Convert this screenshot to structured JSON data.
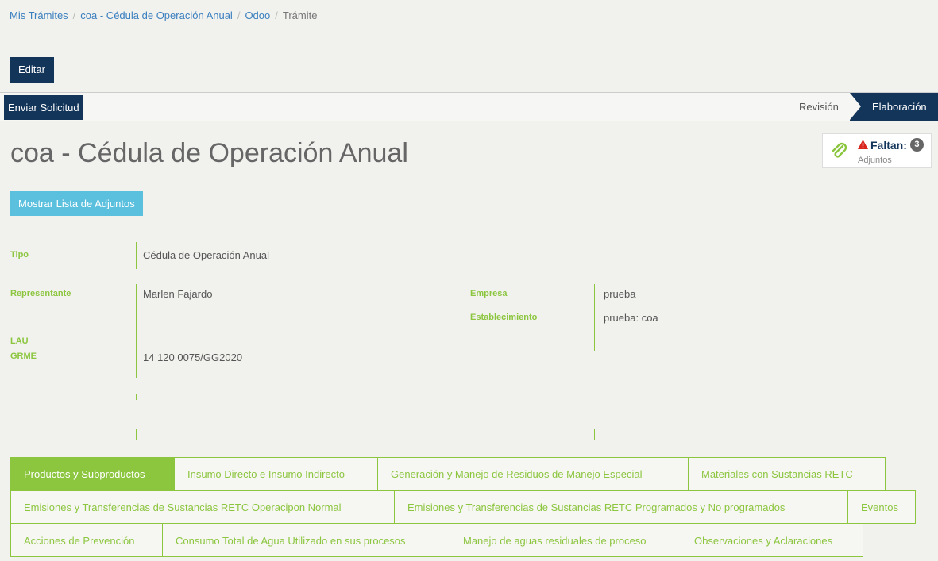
{
  "breadcrumb": {
    "items": [
      "Mis Trámites",
      "coa - Cédula de Operación Anual",
      "Odoo"
    ],
    "current": "Trámite",
    "separator": "/"
  },
  "toolbar": {
    "edit_label": "Editar"
  },
  "statusbar": {
    "send_label": "Enviar Solicitud",
    "stages": [
      "Revisión",
      "Elaboración"
    ],
    "active_stage": "Elaboración"
  },
  "page": {
    "title": "coa - Cédula de Operación Anual"
  },
  "attachments": {
    "missing_label": "Faltan:",
    "missing_count": "3",
    "sub_label": "Adjuntos",
    "show_list_label": "Mostrar Lista de Adjuntos"
  },
  "fields": {
    "tipo": {
      "label": "Tipo",
      "value": "Cédula de Operación Anual"
    },
    "representante": {
      "label": "Representante",
      "value": "Marlen Fajardo"
    },
    "lau": {
      "label": "LAU",
      "value": ""
    },
    "grme": {
      "label": "GRME",
      "value": "14 120 0075/GG2020"
    },
    "empresa": {
      "label": "Empresa",
      "value": "prueba"
    },
    "establecimiento": {
      "label": "Establecimiento",
      "value": "prueba: coa"
    }
  },
  "tabs": [
    [
      "Productos y Subproductos",
      "Insumo Directo e Insumo Indirecto",
      "Generación y Manejo de Residuos de Manejo Especial",
      "Materiales con Sustancias RETC"
    ],
    [
      "Emisiones y Transferencias de Sustancias RETC Operacipon Normal",
      "Emisiones y Transferencias de Sustancias RETC Programados y No programados",
      "Eventos"
    ],
    [
      "Acciones de Prevención",
      "Consumo Total de Agua Utilizado en sus procesos",
      "Manejo de aguas residuales de proceso",
      "Observaciones y Aclaraciones"
    ]
  ],
  "active_tab": "Productos y Subproductos",
  "colors": {
    "navy": "#14355a",
    "accent_green": "#8cc63f",
    "info_blue": "#5bc0de",
    "link_blue": "#3a7fbf",
    "warning_red": "#d9251d"
  },
  "icons": {
    "attachment": "paperclip-icon",
    "warning": "warning-triangle-icon"
  }
}
